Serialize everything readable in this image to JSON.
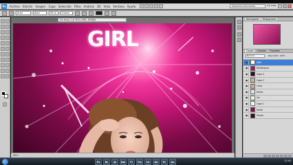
{
  "menubar": {
    "logo": "Ps",
    "items": [
      "Archivo",
      "Edición",
      "Imagen",
      "Capa",
      "Selección",
      "Filtro",
      "Análisis",
      "3D",
      "Vista",
      "Ventana",
      "Ayuda"
    ],
    "workspace": "Aspectos esenciales",
    "cs_live": "CS Live"
  },
  "options": {
    "font": "Arial",
    "style": "Bold",
    "size": "90 pt",
    "antialias": "Fuerte"
  },
  "document": {
    "tab_title": "Sin título-1 al 50% (GIRL, RGB/8)",
    "canvas_text": "GIRL",
    "status": "50%"
  },
  "panels": {
    "top_tabs": [
      "Navegador",
      "Histograma"
    ],
    "layers_tabs": [
      "Capas",
      "Canales",
      "Trazados"
    ],
    "blend_mode": "Normal",
    "opacity_label": "Opacidad: 100%",
    "layers": [
      {
        "name": "GIRL",
        "color": "#ffffff",
        "selected": true
      },
      {
        "name": "Rectángulo",
        "color": "#a31a5e",
        "selected": false
      },
      {
        "name": "Capa 3",
        "color": "#2b0d1e",
        "selected": false
      },
      {
        "name": "Capa 2",
        "color": "#c7b2a8",
        "selected": false
      },
      {
        "name": "chica",
        "color": "#d8a58d",
        "selected": false
      },
      {
        "name": "brillos",
        "color": "#e5e5e5",
        "selected": false
      },
      {
        "name": "luz",
        "color": "#f1f1f1",
        "selected": false
      },
      {
        "name": "Capa 1",
        "color": "#f5f5f5",
        "selected": false
      },
      {
        "name": "fondo",
        "color": "#8a0f4f",
        "selected": false
      },
      {
        "name": "Fondo",
        "color": "#3c0621",
        "selected": false
      }
    ]
  },
  "taskbar": {
    "apps": [
      "Ps",
      "Br",
      "Ai",
      "Dw",
      "Fl",
      "Fw",
      "Id",
      "Ae",
      "Pr",
      "Au"
    ],
    "clock": "12:45"
  }
}
